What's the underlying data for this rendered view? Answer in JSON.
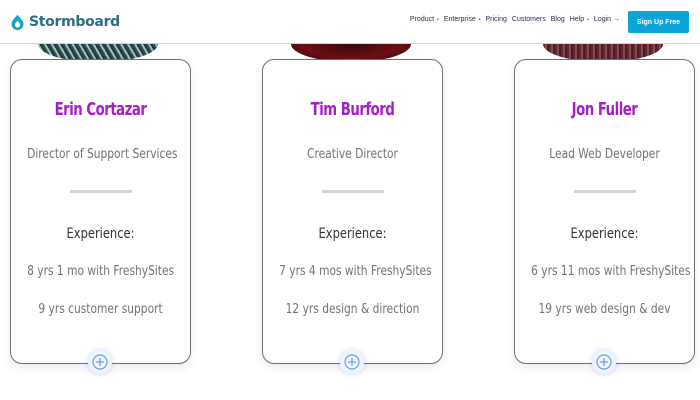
{
  "brand": {
    "name": "Stormboard",
    "logo_icon": "stormboard-logo-icon"
  },
  "nav": {
    "items": [
      {
        "label": "Product",
        "has_dropdown": true
      },
      {
        "label": "Enterprise",
        "has_dropdown": true
      },
      {
        "label": "Pricing",
        "has_dropdown": false
      },
      {
        "label": "Customers",
        "has_dropdown": false
      },
      {
        "label": "Blog",
        "has_dropdown": false
      },
      {
        "label": "Help",
        "has_dropdown": true
      },
      {
        "label": "Login →",
        "has_dropdown": false
      }
    ],
    "cta_label": "Sign Up Free",
    "caret": "•"
  },
  "team": [
    {
      "name": "Erin Cortazar",
      "role": "Director of Support Services",
      "experience_label": "Experience:",
      "experience": [
        "8 yrs 1 mo with FreshySites",
        "9 yrs customer support"
      ]
    },
    {
      "name": "Tim Burford",
      "role": "Creative Director",
      "experience_label": "Experience:",
      "experience": [
        "7 yrs 4 mos with FreshySites",
        "12 yrs design & direction"
      ]
    },
    {
      "name": "Jon Fuller",
      "role": "Lead Web Developer",
      "experience_label": "Experience:",
      "experience": [
        "6 yrs 11 mos with FreshySites",
        "19 yrs web design & dev"
      ]
    }
  ],
  "colors": {
    "accent": "#0aa4d8",
    "name": "#a61fc6",
    "muted_text": "#727277",
    "logo": "#2a6f86"
  }
}
